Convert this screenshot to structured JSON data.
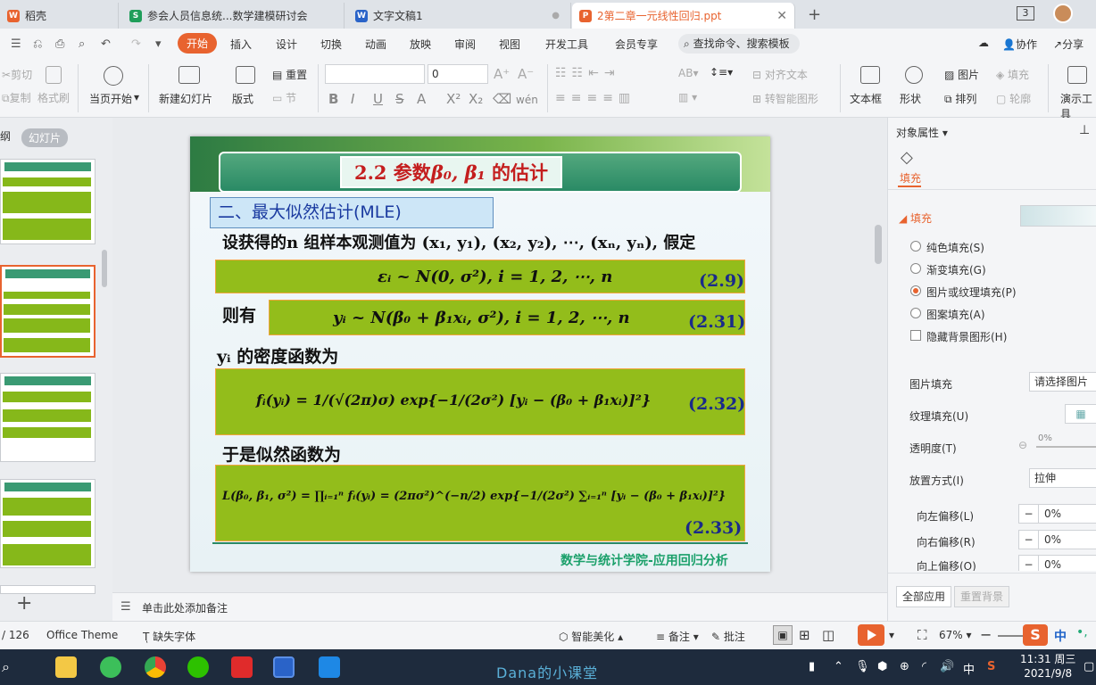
{
  "tabs": [
    {
      "label": "稻壳",
      "icon": "wps-logo-icon",
      "color": "#e8632f"
    },
    {
      "label": "参会人员信息统...数学建模研讨会",
      "icon": "spreadsheet-icon",
      "color": "#1f9e5a"
    },
    {
      "label": "文字文稿1",
      "icon": "writer-icon",
      "color": "#2a63c8"
    },
    {
      "label": "2第二章一元线性回归.ppt",
      "icon": "presentation-icon",
      "color": "#e8632f",
      "active": true
    }
  ],
  "window": {
    "count": "3"
  },
  "menu": {
    "items": [
      "开始",
      "插入",
      "设计",
      "切换",
      "动画",
      "放映",
      "审阅",
      "视图",
      "开发工具",
      "会员专享"
    ],
    "active": "开始",
    "search": "查找命令、搜索模板",
    "collab": "协作",
    "share": "分享"
  },
  "ribbon": {
    "cut": "剪切",
    "paste_label": "粘贴",
    "copy": "复制",
    "format_painter": "格式刷",
    "from_current": "当页开始",
    "new_slide": "新建幻灯片",
    "layout": "版式",
    "reset": "重置",
    "section": "节",
    "font_size": "0",
    "text_direction": "对齐文本",
    "smart_art": "转智能图形",
    "textbox": "文本框",
    "shape": "形状",
    "picture": "图片",
    "fill": "填充",
    "arrange": "排列",
    "outline": "轮廓",
    "presenter_tools": "演示工具"
  },
  "leftpanel": {
    "tab_outline": "纲",
    "tab_slides": "幻灯片"
  },
  "slide": {
    "title_prefix": "2.2 参数",
    "title_symbol": "β₀, β₁",
    "title_suffix": " 的估计",
    "section": "二、最大似然估计(MLE)",
    "line1": "设获得的n 组样本观测值为 (x₁, y₁), (x₂, y₂), ⋯, (xₙ, yₙ), 假定",
    "eq29": "εᵢ ~ N(0, σ²),      i = 1, 2, ⋯, n",
    "tag29": "(2.9)",
    "then": "则有",
    "eq231": "yᵢ ~ N(β₀ + β₁xᵢ, σ²),  i = 1, 2, ⋯, n",
    "tag231": "(2.31)",
    "density_label": "yᵢ 的密度函数为",
    "eq232": "fᵢ(yᵢ) = 1/(√(2π)σ) exp{−1/(2σ²) [yᵢ − (β₀ + β₁xᵢ)]²}",
    "tag232": "(2.32)",
    "likelihood_label": "于是似然函数为",
    "eq233": "L(β₀, β₁, σ²) = ∏ᵢ₌₁ⁿ fᵢ(yᵢ) = (2πσ²)^(−n/2) exp{−1/(2σ²) ∑ᵢ₌₁ⁿ [yᵢ − (β₀ + β₁xᵢ)]²}",
    "tag233": "(2.33)",
    "footer": "数学与统计学院-应用回归分析"
  },
  "notes": {
    "placeholder": "单击此处添加备注"
  },
  "rightpanel": {
    "title": "对象属性",
    "tab_fill": "填充",
    "section_fill": "填充",
    "options": [
      "纯色填充(S)",
      "渐变填充(G)",
      "图片或纹理填充(P)",
      "图案填充(A)"
    ],
    "selected_option": "图片或纹理填充(P)",
    "hide_bg": "隐藏背景图形(H)",
    "picture_fill_label": "图片填充",
    "picture_fill_value": "请选择图片",
    "texture_label": "纹理填充(U)",
    "transparency_label": "透明度(T)",
    "transparency_value": "0%",
    "placement_label": "放置方式(I)",
    "placement_value": "拉伸",
    "offset_left_label": "向左偏移(L)",
    "offset_left_value": "0%",
    "offset_right_label": "向右偏移(R)",
    "offset_right_value": "0%",
    "offset_up_label": "向上偏移(O)",
    "offset_up_value": "0%",
    "apply_all": "全部应用",
    "reset_bg": "重置背景"
  },
  "status": {
    "page": "/ 126",
    "theme": "Office Theme",
    "missing_font": "缺失字体",
    "smart_beautify": "智能美化",
    "notes": "备注",
    "comments": "批注",
    "zoom": "67%"
  },
  "taskbar": {
    "center_text": "Dana的小课堂",
    "ime": "中",
    "time": "11:31 周三",
    "date": "2021/9/8"
  }
}
